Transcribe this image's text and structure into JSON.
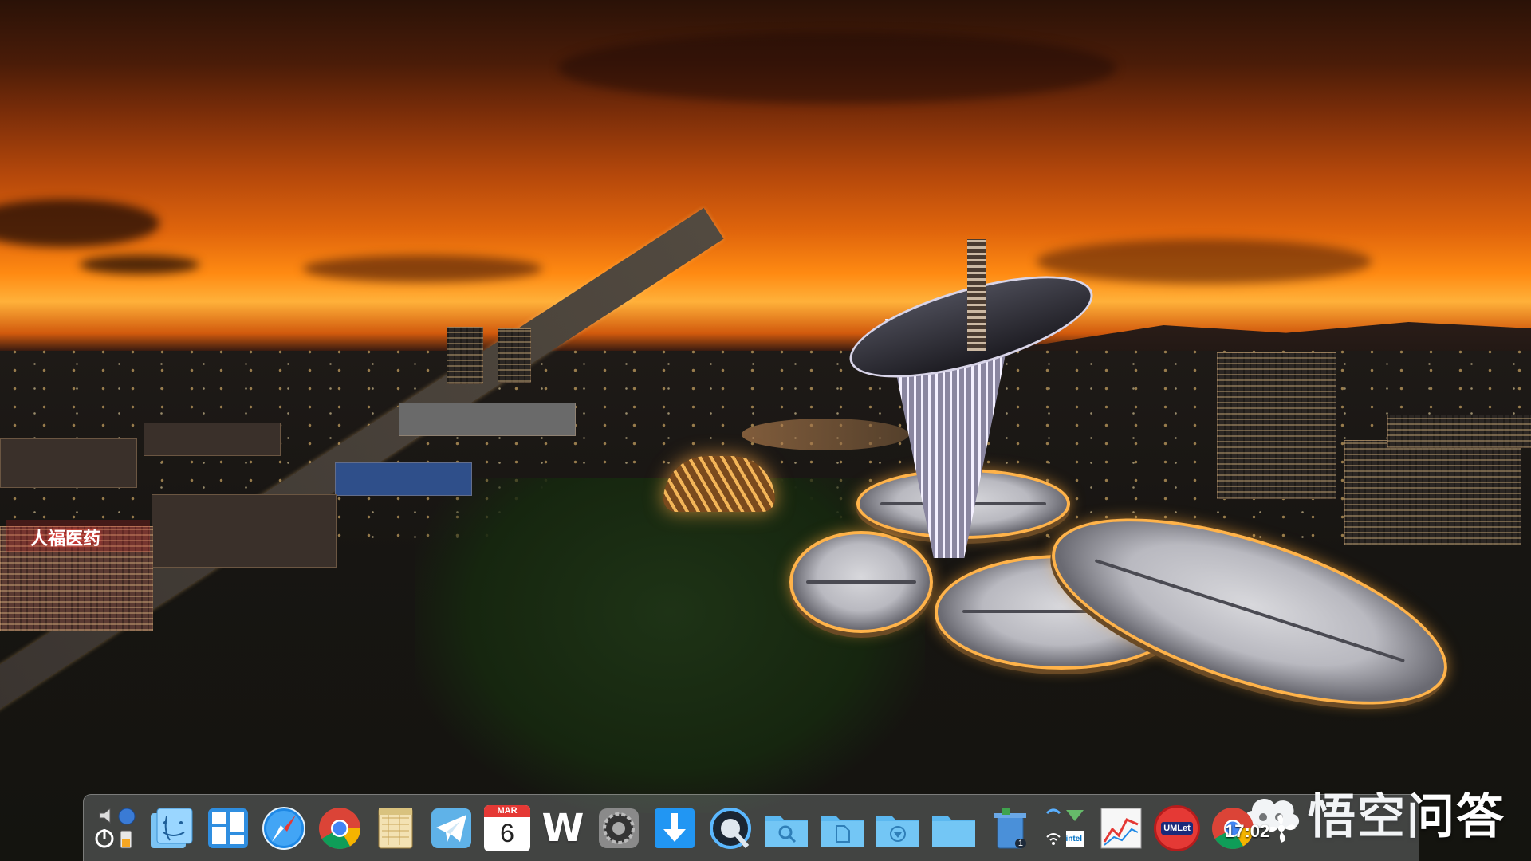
{
  "desktop": {
    "wallpaper": "sunset-city-aerial",
    "building_sign_text": "人福医药",
    "watermark_text": "悟空问答",
    "clock": "17:02"
  },
  "dock": {
    "calendar_month": "MAR",
    "calendar_day": "6",
    "wps_letter": "W",
    "umlet_label": "UMLet",
    "intel_label": "intel",
    "trash_badge": "1",
    "items": [
      {
        "name": "system-controls",
        "icon": "power-volume-cluster"
      },
      {
        "name": "finder",
        "icon": "finder-face-icon"
      },
      {
        "name": "mission-control",
        "icon": "window-grid-icon"
      },
      {
        "name": "safari",
        "icon": "compass-icon"
      },
      {
        "name": "chrome",
        "icon": "chrome-icon"
      },
      {
        "name": "notes-ledger",
        "icon": "ledger-icon"
      },
      {
        "name": "telegram",
        "icon": "paper-plane-icon"
      },
      {
        "name": "calendar",
        "icon": "calendar-icon"
      },
      {
        "name": "wps-writer",
        "icon": "w-letter-icon"
      },
      {
        "name": "system-preferences",
        "icon": "gear-icon"
      },
      {
        "name": "downloader",
        "icon": "download-arrow-icon"
      },
      {
        "name": "quicktime",
        "icon": "q-player-icon"
      },
      {
        "name": "folder-search",
        "icon": "folder-search-icon"
      },
      {
        "name": "folder-documents",
        "icon": "folder-document-icon"
      },
      {
        "name": "folder-downloads",
        "icon": "folder-download-icon"
      },
      {
        "name": "folder-generic",
        "icon": "folder-icon"
      },
      {
        "name": "trash",
        "icon": "trash-icon"
      },
      {
        "name": "status-monitor",
        "icon": "network-intel-icon"
      },
      {
        "name": "stock-chart",
        "icon": "line-chart-icon"
      },
      {
        "name": "umlet",
        "icon": "umlet-icon"
      },
      {
        "name": "chrome-2",
        "icon": "chrome-icon"
      }
    ]
  },
  "colors": {
    "sky_top": "#2a1207",
    "sky_glow": "#ff8a12",
    "chrome_red": "#db4437",
    "chrome_yellow": "#f4b400",
    "chrome_green": "#0f9d58",
    "chrome_blue": "#4285f4",
    "folder_blue": "#5cb8f0"
  }
}
